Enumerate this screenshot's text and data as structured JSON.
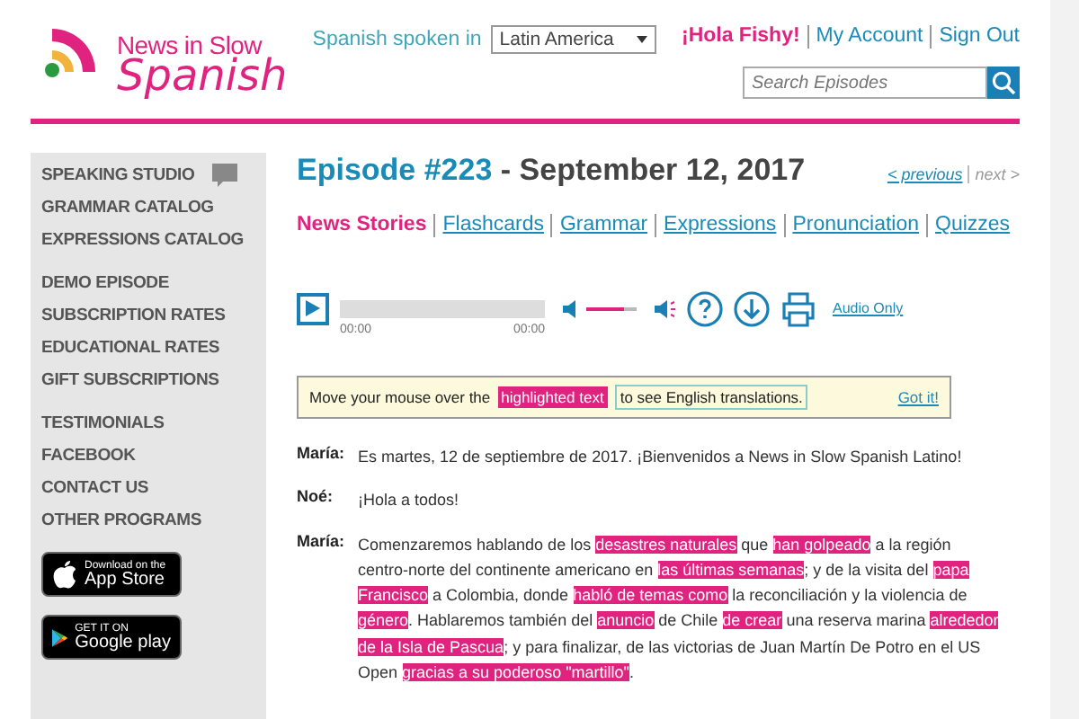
{
  "logo": {
    "top": "News in Slow",
    "bottom": "Spanish"
  },
  "region": {
    "label": "Spanish spoken in",
    "value": "Latin America"
  },
  "account": {
    "greeting": "¡Hola Fishy!",
    "links": [
      "My Account",
      "Sign Out"
    ]
  },
  "search": {
    "placeholder": "Search Episodes"
  },
  "sidebar": {
    "groups": [
      [
        {
          "label": "SPEAKING STUDIO",
          "kind": "chat"
        },
        {
          "label": "GRAMMAR CATALOG",
          "kind": "plain"
        },
        {
          "label": "EXPRESSIONS CATALOG",
          "kind": "plain"
        }
      ],
      [
        {
          "label": "DEMO EPISODE",
          "kind": "plain"
        },
        {
          "label": "SUBSCRIPTION RATES",
          "kind": "plain"
        },
        {
          "label": "EDUCATIONAL RATES",
          "kind": "plain"
        },
        {
          "label": "GIFT SUBSCRIPTIONS",
          "kind": "plain"
        }
      ],
      [
        {
          "label": "TESTIMONIALS",
          "kind": "plain"
        },
        {
          "label": "FACEBOOK",
          "kind": "plain"
        },
        {
          "label": "CONTACT US",
          "kind": "plain"
        },
        {
          "label": "OTHER PROGRAMS",
          "kind": "plain"
        }
      ]
    ],
    "badges": [
      {
        "kind": "apple",
        "small": "Download on the",
        "big": "App Store"
      },
      {
        "kind": "google",
        "small": "GET IT ON",
        "big": "Google play"
      }
    ]
  },
  "episode": {
    "number": "Episode #223",
    "date": "- September 12, 2017",
    "previous": "< previous",
    "next": "next >"
  },
  "tabs": [
    {
      "label": "News Stories",
      "selected": true
    },
    {
      "label": "Flashcards",
      "selected": false
    },
    {
      "label": "Grammar",
      "selected": false
    },
    {
      "label": "Expressions",
      "selected": false
    },
    {
      "label": "Pronunciation",
      "selected": false
    },
    {
      "label": "Quizzes",
      "selected": false
    }
  ],
  "player": {
    "elapsed": "00:00",
    "duration": "00:00",
    "level": 0.0,
    "volume": {
      "level": 0.75
    },
    "audio_only": "Audio Only"
  },
  "hint": {
    "before": "Move your mouse over the",
    "highlight": "highlighted text",
    "after": "to see English translations.",
    "dismiss": "Got it!"
  },
  "transcript": [
    {
      "speaker": "María:",
      "segments": [
        {
          "text": "Es martes, 12 de septiembre de 2017. ¡Bienvenidos a News in Slow Spanish Latino!",
          "highlight": false
        }
      ]
    },
    {
      "speaker": "Noé:",
      "segments": [
        {
          "text": "¡Hola a todos!",
          "highlight": false
        }
      ]
    },
    {
      "speaker": "María:",
      "segments": [
        {
          "text": "Comenzaremos hablando de los ",
          "highlight": false
        },
        {
          "text": "desastres naturales",
          "highlight": true
        },
        {
          "text": " que ",
          "highlight": false
        },
        {
          "text": "han golpeado",
          "highlight": true
        },
        {
          "text": " a la región centro-norte del continente americano en ",
          "highlight": false
        },
        {
          "text": "las últimas semanas",
          "highlight": true
        },
        {
          "text": "; y de la visita del ",
          "highlight": false
        },
        {
          "text": "papa Francisco",
          "highlight": true
        },
        {
          "text": " a Colombia, donde ",
          "highlight": false
        },
        {
          "text": "habló de temas como",
          "highlight": true
        },
        {
          "text": " la reconciliación y la violencia de ",
          "highlight": false
        },
        {
          "text": "género",
          "highlight": true
        },
        {
          "text": ". Hablaremos también del ",
          "highlight": false
        },
        {
          "text": "anuncio",
          "highlight": true
        },
        {
          "text": " de Chile ",
          "highlight": false
        },
        {
          "text": "de crear",
          "highlight": true
        },
        {
          "text": " una reserva marina ",
          "highlight": false
        },
        {
          "text": "alrededor de la Isla de Pascua",
          "highlight": true
        },
        {
          "text": "; y para finalizar, de las victorias de Juan Martín De Potro en el US Open ",
          "highlight": false
        },
        {
          "text": "gracias a su poderoso \"martillo\"",
          "highlight": true
        },
        {
          "text": ".",
          "highlight": false
        }
      ]
    }
  ]
}
